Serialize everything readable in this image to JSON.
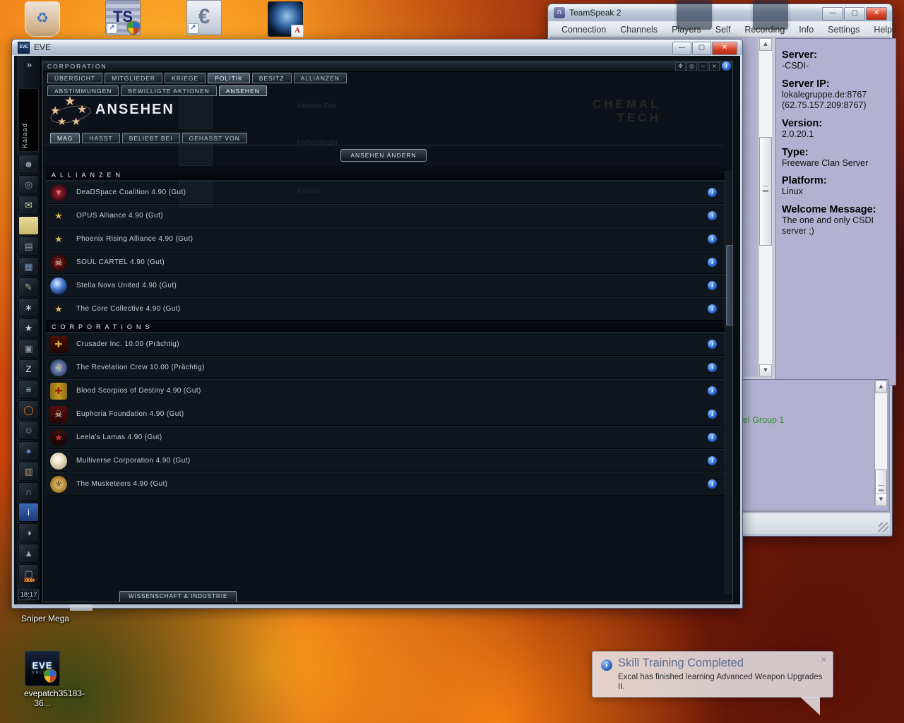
{
  "glyphs": {
    "min": "—",
    "max": "▢",
    "close": "✕",
    "up": "▲",
    "down": "▼",
    "info_i": "i",
    "recycle": "♻",
    "shortcut": "↗",
    "pdf_badge": "A"
  },
  "desktop": {
    "icons": [
      {
        "name": "recycle-bin",
        "label": ""
      },
      {
        "name": "teamspeak-shortcut",
        "glyph": "TS"
      },
      {
        "name": "euro-shortcut",
        "glyph": "€"
      },
      {
        "name": "pdf-planet-file",
        "glyph": ""
      }
    ],
    "sniper_label": "Sniper Mega",
    "evepatch_label": "evepatch35183-36...",
    "evepatch_glyph": "EVE",
    "evepatch_sub": "ONLINE"
  },
  "teamspeak": {
    "title": "TeamSpeak 2",
    "menu": [
      "Connection",
      "Channels",
      "Players",
      "Self",
      "Recording",
      "Info",
      "Settings",
      "Help"
    ],
    "info_panel": [
      {
        "label": "Server:",
        "value": "-CSDI-"
      },
      {
        "label": "Server IP:",
        "value": "lokalegruppe.de:8767 (62.75.157.209:8767)"
      },
      {
        "label": "Version:",
        "value": "2.0.20.1"
      },
      {
        "label": "Type:",
        "value": "Freeware Clan Server"
      },
      {
        "label": "Platform:",
        "value": "Linux"
      },
      {
        "label": "Welcome Message:",
        "value": "The one and only CSDI server ;)"
      }
    ],
    "log_text": "el Group 1"
  },
  "eve_window": {
    "title": "EVE",
    "logo_text": "EVE",
    "neocom": {
      "expand_glyph": "»",
      "character": "Kalaad",
      "more_glyph": "»»»",
      "clock": "18:17",
      "icons": [
        {
          "name": "character-sheet-icon",
          "glyph": "☻"
        },
        {
          "name": "market-icon",
          "glyph": "◎"
        },
        {
          "name": "mail-icon",
          "glyph": "✉",
          "fg": "#d8cfa0"
        },
        {
          "name": "notepad-icon",
          "glyph": "",
          "bg": "linear-gradient(#e8dc9a,#c8b868)"
        },
        {
          "name": "people-places-icon",
          "glyph": "▤"
        },
        {
          "name": "wallet-icon",
          "glyph": "▦",
          "fg": "#6f94b8"
        },
        {
          "name": "contracts-icon",
          "glyph": "✎",
          "fg": "#b8a88c"
        },
        {
          "name": "map-icon",
          "glyph": "∗",
          "fg": "#cfd8e2"
        },
        {
          "name": "corporation-icon",
          "glyph": "★",
          "fg": "#c8ccd4"
        },
        {
          "name": "assets-icon",
          "glyph": "▣"
        },
        {
          "name": "log-off-icon",
          "glyph": "Z",
          "fg": "#e8ecf0"
        },
        {
          "name": "calculator-icon",
          "glyph": "≡",
          "fg": "#9ec8b8"
        },
        {
          "name": "help-ring-icon",
          "glyph": "◯",
          "fg": "#e87818"
        },
        {
          "name": "chat-icon",
          "glyph": "☺"
        },
        {
          "name": "browser-icon",
          "glyph": "●",
          "fg": "#5888b8"
        },
        {
          "name": "journal-icon",
          "glyph": "▥",
          "fg": "#a89878"
        },
        {
          "name": "audio-icon",
          "glyph": "∩",
          "fg": "#8890a0"
        },
        {
          "name": "tutorial-icon",
          "glyph": "i",
          "fg": "#ffffff",
          "bg": "linear-gradient(#3a6ab8,#1c3a78)"
        },
        {
          "name": "character-icon",
          "glyph": "◑",
          "fg": "#c8ccd0"
        },
        {
          "name": "ship-icon",
          "glyph": "▲",
          "fg": "#9aa2ac"
        },
        {
          "name": "items-icon",
          "glyph": "▢",
          "fg": "#a0a8b0"
        }
      ]
    },
    "corp_panel": {
      "title": "CORPORATION",
      "window_icons": [
        {
          "name": "pin-icon",
          "glyph": "✥"
        },
        {
          "name": "toggle-icon",
          "glyph": "◎"
        },
        {
          "name": "minimize-icon",
          "glyph": "−"
        },
        {
          "name": "close-icon",
          "glyph": "×"
        }
      ],
      "main_tabs": [
        {
          "label": "ÜBERSICHT",
          "active": false
        },
        {
          "label": "MITGLIEDER",
          "active": false
        },
        {
          "label": "KRIEGE",
          "active": false
        },
        {
          "label": "POLITIK",
          "active": true
        },
        {
          "label": "BESITZ",
          "active": false
        },
        {
          "label": "ALLIANZEN",
          "active": false
        }
      ],
      "sub_tabs": [
        {
          "label": "ABSTIMMUNGEN",
          "active": false
        },
        {
          "label": "BEWILLIGTE AKTIONEN",
          "active": false
        },
        {
          "label": "ANSEHEN",
          "active": true
        }
      ],
      "page_title": "ANSEHEN",
      "standing_tabs": [
        {
          "label": "MAG",
          "active": true
        },
        {
          "label": "HASST",
          "active": false
        },
        {
          "label": "BELIEBT BEI",
          "active": false
        },
        {
          "label": "GEHASST VON",
          "active": false
        }
      ],
      "change_button": "ANSEHEN ÄNDERN",
      "sections": [
        {
          "header": "ALLIANZEN",
          "rows": [
            {
              "label": "DeaDSpace Coalition 4.90 (Gut)",
              "logo": {
                "name": "deadspace-coalition",
                "bg": "radial-gradient(circle,#8a1828 25%,#2a0a12 78%)",
                "glyph": "▼",
                "fg": "#d87070",
                "shape": "round"
              }
            },
            {
              "label": "OPUS Alliance 4.90 (Gut)",
              "logo": {
                "name": "opus-alliance",
                "bg": "transparent",
                "glyph": "★",
                "fg": "#d8b85a"
              }
            },
            {
              "label": "Phoenix Rising Alliance 4.90 (Gut)",
              "logo": {
                "name": "phoenix-rising-alliance",
                "bg": "transparent",
                "glyph": "★",
                "fg": "#d8b85a"
              }
            },
            {
              "label": "SOUL CARTEL 4.90 (Gut)",
              "logo": {
                "name": "soul-cartel",
                "bg": "radial-gradient(circle,#6a1414 25%,#1a0606 80%)",
                "glyph": "☠",
                "fg": "#e0dccc",
                "shape": "round"
              }
            },
            {
              "label": "Stella Nova United 4.90 (Gut)",
              "logo": {
                "name": "stella-nova-united",
                "bg": "radial-gradient(circle at 40% 35%,#cfe4ff 5%,#5a8ad8 35%,#16306e 75%)",
                "glyph": "",
                "fg": "#fff",
                "shape": "round"
              }
            },
            {
              "label": "The Core Collective 4.90 (Gut)",
              "logo": {
                "name": "the-core-collective",
                "bg": "transparent",
                "glyph": "★",
                "fg": "#d8b85a"
              }
            }
          ]
        },
        {
          "header": "CORPORATIONS",
          "rows": [
            {
              "label": "Crusader Inc. 10.00 (Prächtig)",
              "logo": {
                "name": "crusader-inc",
                "bg": "linear-gradient(#4a1006,#200603)",
                "glyph": "✚",
                "fg": "#d8a23c"
              }
            },
            {
              "label": "The Revelation Crew 10.00 (Prächtig)",
              "logo": {
                "name": "the-revelation-crew",
                "bg": "radial-gradient(circle,#8aa2cc 10%,#32436e 72%)",
                "glyph": "♌",
                "fg": "#e8c860",
                "shape": "round"
              }
            },
            {
              "label": "Blood Scorpios of Destiny 4.90 (Gut)",
              "logo": {
                "name": "blood-scorpios-of-destiny",
                "bg": "linear-gradient(90deg,#8a6a14,#c49a20 50%,#8a6a14)",
                "glyph": "✚",
                "fg": "#a01810"
              }
            },
            {
              "label": "Euphoria Foundation 4.90 (Gut)",
              "logo": {
                "name": "euphoria-foundation",
                "bg": "linear-gradient(#5a0e0e,#2a0505)",
                "glyph": "☠",
                "fg": "#e8e2d2"
              }
            },
            {
              "label": "Leela's Lamas 4.90 (Gut)",
              "logo": {
                "name": "leelas-lamas",
                "bg": "linear-gradient(#38100e,#180404)",
                "glyph": "★",
                "fg": "#c83030",
                "shape": "round"
              }
            },
            {
              "label": "Multiverse Corporation 4.90 (Gut)",
              "logo": {
                "name": "multiverse-corporation",
                "bg": "radial-gradient(circle at 45% 40%,#f8f2e0 20%,#c8b890 70%,#907848)",
                "glyph": "",
                "fg": "#fff",
                "shape": "round"
              }
            },
            {
              "label": "The Musketeers 4.90 (Gut)",
              "logo": {
                "name": "the-musketeers",
                "bg": "radial-gradient(circle,#e0c070 15%,#a07828 70%,#604810)",
                "glyph": "⚜",
                "fg": "#5a3c0c",
                "shape": "round"
              }
            }
          ]
        }
      ],
      "bottom_tab": "WISSENSCHAFT & INDUSTRIE",
      "watermark": {
        "line1": "CHEMAL",
        "line2": "TECH"
      },
      "ghost_members": [
        "Hunters Fire",
        "HyPerBlaziN",
        "Kalaad"
      ]
    }
  },
  "notification": {
    "title": "Skill Training Completed",
    "body": "Excal has finished learning Advanced Weapon Upgrades II.",
    "close_glyph": "✕"
  }
}
